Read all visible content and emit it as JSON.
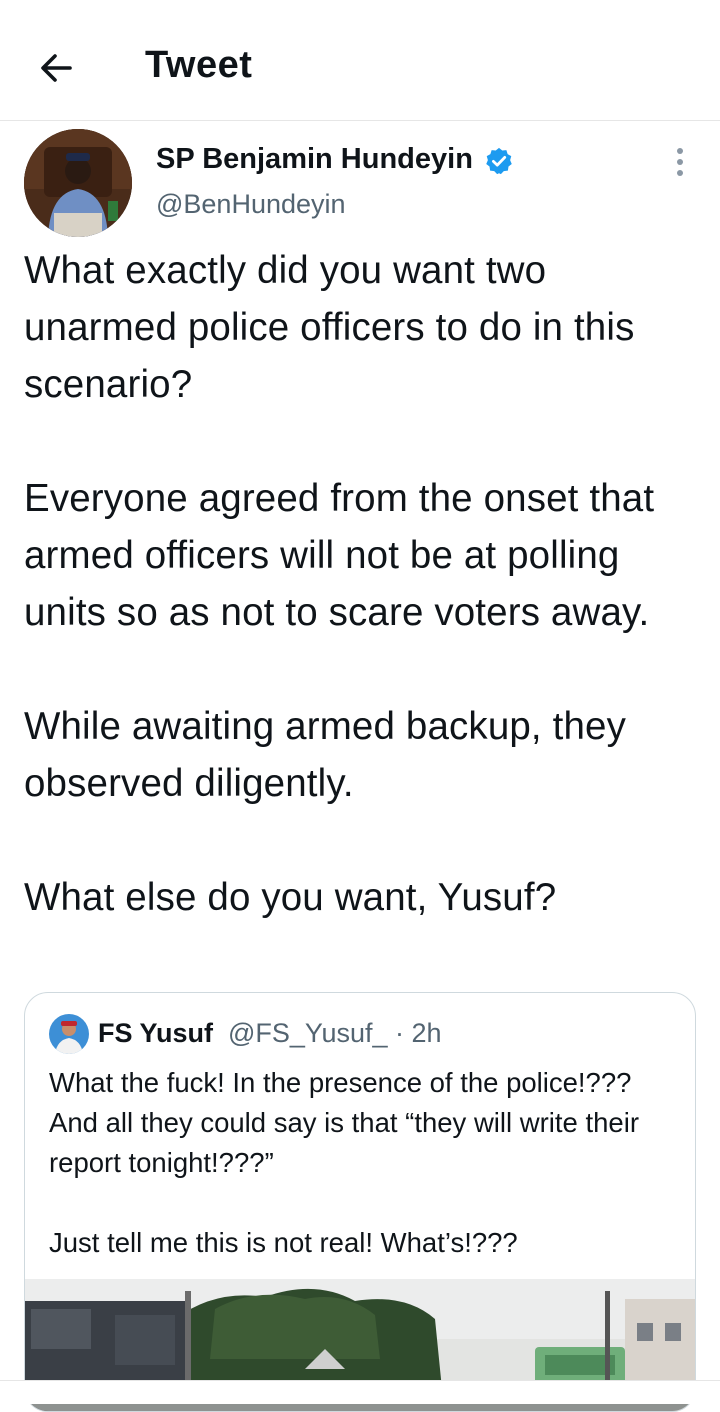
{
  "header": {
    "title": "Tweet"
  },
  "tweet": {
    "author_name": "SP Benjamin Hundeyin",
    "author_handle": "@BenHundeyin",
    "text": "What exactly did you want two unarmed police officers to do in this scenario?\n\nEveryone agreed from the onset that armed officers will not be at polling units so as not to scare voters away.\n\nWhile awaiting armed backup, they observed diligently.\n\nWhat else do you want, Yusuf?"
  },
  "quoted_tweet": {
    "author_name": "FS Yusuf",
    "author_handle": "@FS_Yusuf_",
    "separator": "·",
    "time": "2h",
    "text": "What the fuck! In the presence of the police!??? And all they could say is that “they will write their report tonight!???”\n\nJust tell me this is not real! What’s!???"
  },
  "icons": {
    "back": "arrow-left-icon",
    "verified": "verified-badge-icon",
    "more": "more-vertical-icon"
  },
  "colors": {
    "verified": "#1d9bf0",
    "secondary_text": "#536471",
    "border": "#cfd9de"
  }
}
